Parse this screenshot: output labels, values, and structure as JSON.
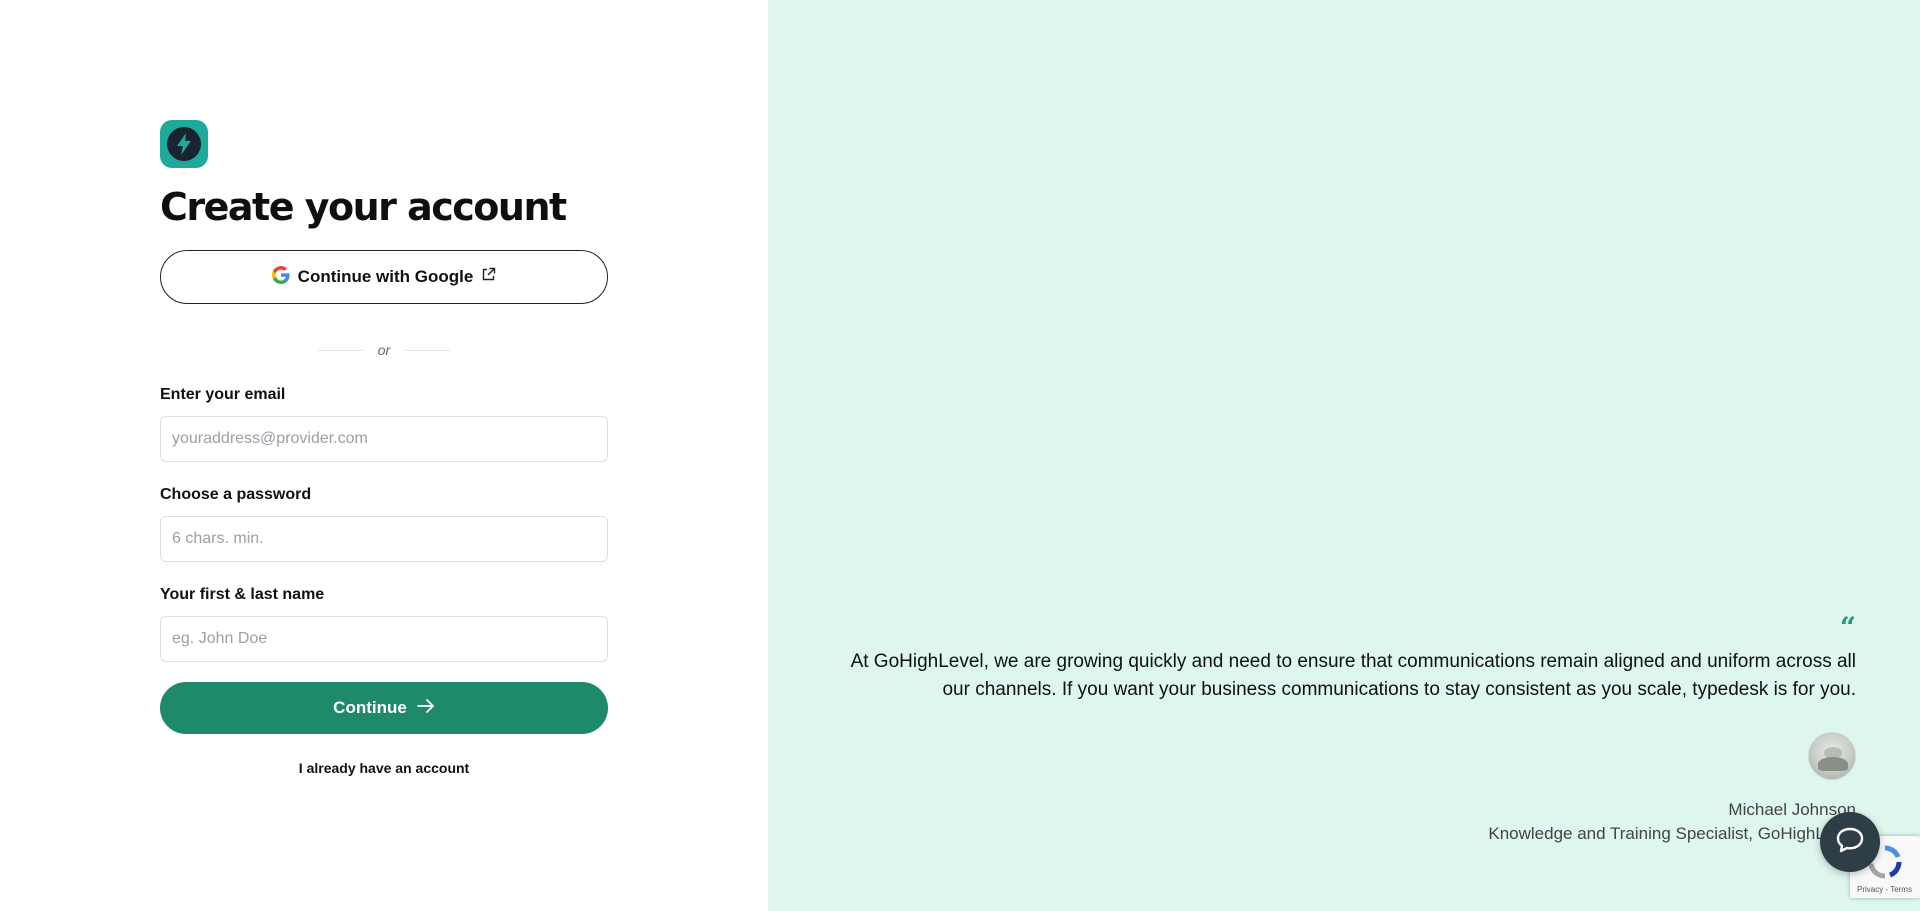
{
  "form": {
    "title": "Create your account",
    "google_label": "Continue with Google",
    "divider_text": "or",
    "email_label": "Enter your email",
    "email_placeholder": "youraddress@provider.com",
    "email_value": "",
    "password_label": "Choose a password",
    "password_placeholder": "6 chars. min.",
    "password_value": "",
    "name_label": "Your first & last name",
    "name_placeholder": "eg. John Doe",
    "name_value": "",
    "continue_label": "Continue",
    "have_account_label": "I already have an account"
  },
  "testimonial": {
    "quote_mark": "“",
    "quote_line1": "At GoHighLevel, we are growing quickly and need to ensure that communications remain aligned and uniform across all",
    "quote_line2": "our channels. If you want your business communications to stay consistent as you scale, typedesk is for you.",
    "author_name": "Michael Johnson",
    "author_role": "Knowledge and Training Specialist, GoHighLevel"
  },
  "recaptcha": {
    "links": "Privacy - Terms"
  },
  "icons": {
    "logo": "bolt-icon",
    "google": "google-g-icon",
    "external": "external-link-icon",
    "arrow": "arrow-right-icon",
    "chat": "chat-bubble-icon"
  },
  "colors": {
    "accent": "#1f8a6b",
    "logo_bg": "#1fa99a",
    "right_panel_bg": "#ddf6ee",
    "quote_accent": "#1f9b7a"
  }
}
